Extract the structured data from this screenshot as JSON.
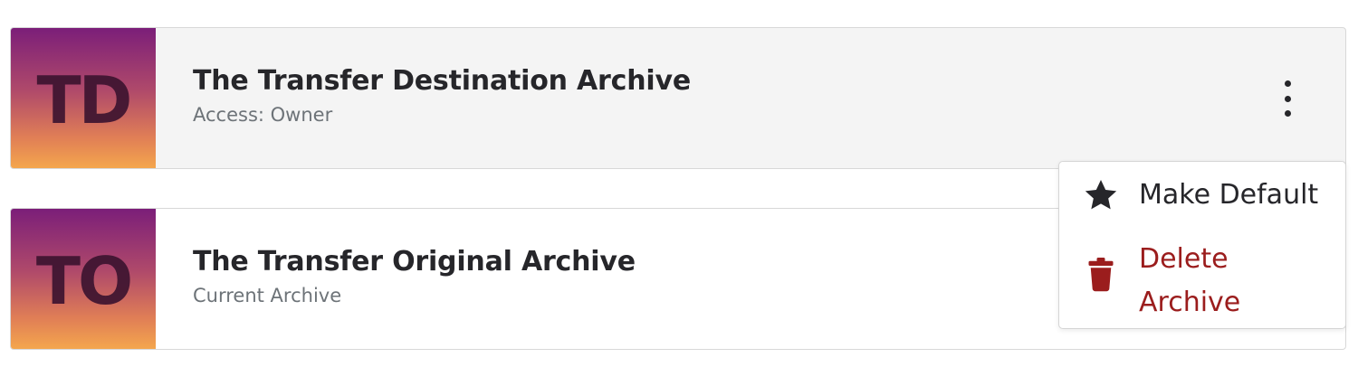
{
  "archives": [
    {
      "initials": "TD",
      "title": "The Transfer Destination Archive",
      "subtitle": "Access: Owner"
    },
    {
      "initials": "TO",
      "title": "The Transfer Original Archive",
      "subtitle": "Current Archive"
    }
  ],
  "menu": {
    "items": [
      {
        "label": "Make Default",
        "icon": "star-icon",
        "color": "#26262a"
      },
      {
        "label": "Delete Archive",
        "icon": "trash-icon",
        "color": "#9b1d1d"
      }
    ]
  },
  "colors": {
    "card_active_bg": "#f4f4f4",
    "text_primary": "#26262a",
    "text_secondary": "#6d7378",
    "danger": "#9b1d1d",
    "thumb_gradient_top": "#7b1e79",
    "thumb_gradient_bottom": "#f4a64d"
  }
}
